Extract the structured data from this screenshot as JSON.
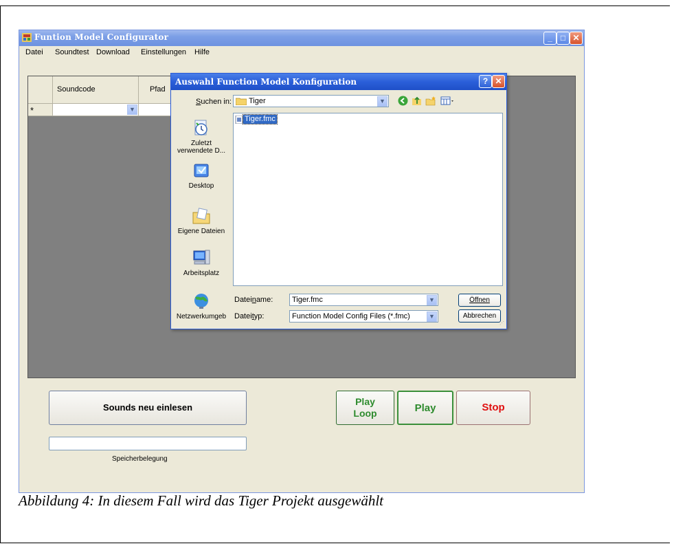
{
  "window": {
    "title": "Funtion Model Configurator",
    "menu": [
      "Datei",
      "Soundtest",
      "Download",
      "Einstellungen",
      "Hilfe"
    ]
  },
  "grid": {
    "columns": [
      "Soundcode",
      "Pfad"
    ],
    "new_row_marker": "*"
  },
  "buttons": {
    "reload_sounds": "Sounds neu einlesen",
    "play_loop_line1": "Play",
    "play_loop_line2": "Loop",
    "play": "Play",
    "stop": "Stop"
  },
  "memory": {
    "label": "Speicherbelegung",
    "usage_fraction": 0
  },
  "dialog": {
    "title": "Auswahl Function Model Konfiguration",
    "help_button": "?",
    "lookin_label": "Suchen in:",
    "lookin_value": "Tiger",
    "places": [
      {
        "icon": "recent-icon",
        "label_line1": "Zuletzt",
        "label_line2": "verwendete D..."
      },
      {
        "icon": "desktop-icon",
        "label_line1": "Desktop",
        "label_line2": ""
      },
      {
        "icon": "my-documents-icon",
        "label_line1": "Eigene Dateien",
        "label_line2": ""
      },
      {
        "icon": "my-computer-icon",
        "label_line1": "Arbeitsplatz",
        "label_line2": ""
      },
      {
        "icon": "network-icon",
        "label_line1": "Netzwerkumgeb",
        "label_line2": ""
      }
    ],
    "files": [
      "Tiger.fmc"
    ],
    "filename_label": "Dateiname:",
    "filename_value": "Tiger.fmc",
    "filetype_label": "Dateityp:",
    "filetype_value": "Function Model Config Files (*.fmc)",
    "open_button": "Öffnen",
    "cancel_button": "Abbrechen"
  },
  "caption": "Abbildung 4: In diesem Fall wird das Tiger Projekt ausgewählt",
  "colors": {
    "play_green": "#2e8b2e",
    "stop_red": "#e01010",
    "grid_bg": "#808080",
    "selection_blue": "#316ac5"
  }
}
